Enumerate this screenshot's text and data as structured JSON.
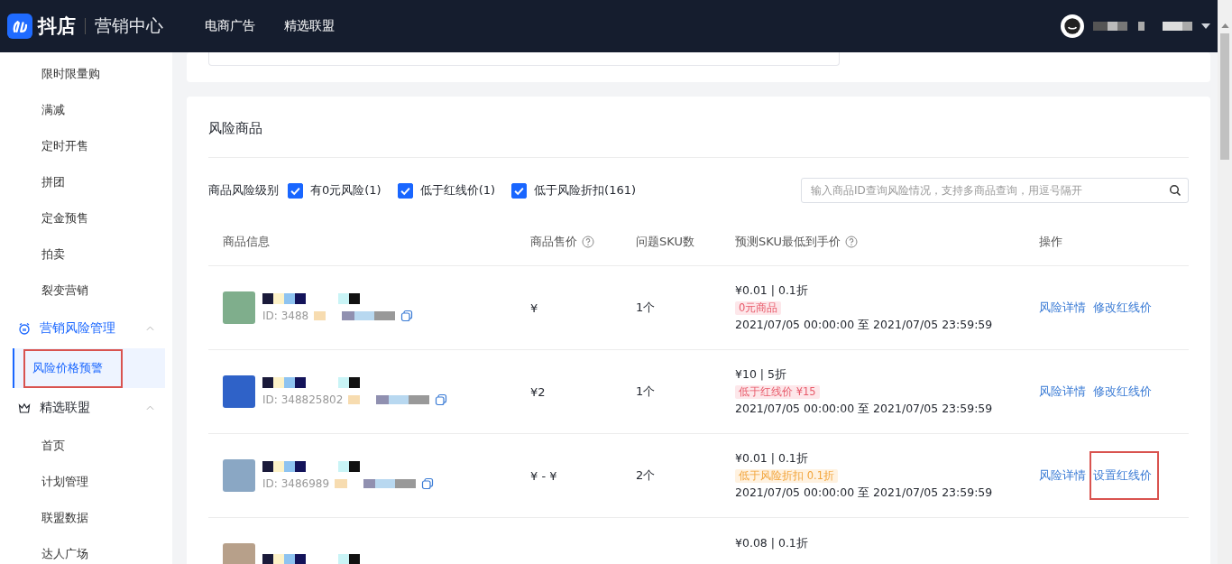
{
  "header": {
    "logo_text": "抖店",
    "section": "营销中心",
    "nav": [
      {
        "label": "电商广告"
      },
      {
        "label": "精选联盟"
      }
    ]
  },
  "sidebar": [
    {
      "kind": "item",
      "label": "限时限量购"
    },
    {
      "kind": "item",
      "label": "满减"
    },
    {
      "kind": "item",
      "label": "定时开售"
    },
    {
      "kind": "item",
      "label": "拼团"
    },
    {
      "kind": "item",
      "label": "定金预售"
    },
    {
      "kind": "item",
      "label": "拍卖"
    },
    {
      "kind": "item",
      "label": "裂变营销"
    },
    {
      "kind": "group",
      "label": "营销风险管理",
      "active": true,
      "expanded": true,
      "children": [
        {
          "label": "风险价格预警",
          "selected": true,
          "highlighted": true
        }
      ]
    },
    {
      "kind": "group",
      "label": "精选联盟",
      "active": false,
      "expanded": true,
      "children": [
        {
          "label": "首页",
          "selected": false,
          "highlighted": false
        },
        {
          "label": "计划管理",
          "selected": false,
          "highlighted": false
        },
        {
          "label": "联盟数据",
          "selected": false,
          "highlighted": false
        },
        {
          "label": "达人广场",
          "selected": false,
          "highlighted": false
        }
      ]
    }
  ],
  "card": {
    "title": "风险商品",
    "filter_label": "商品风险级别",
    "filters": [
      {
        "label": "有0元风险(1)",
        "checked": true
      },
      {
        "label": "低于红线价(1)",
        "checked": true
      },
      {
        "label": "低于风险折扣(161)",
        "checked": true
      }
    ],
    "search": {
      "placeholder": "输入商品ID查询风险情况，支持多商品查询，用逗号隔开"
    },
    "columns": [
      {
        "label": "商品信息",
        "help": false
      },
      {
        "label": "商品售价",
        "help": true
      },
      {
        "label": "问题SKU数",
        "help": false
      },
      {
        "label": "预测SKU最低到手价",
        "help": true
      },
      {
        "label": "操作",
        "help": false
      }
    ],
    "rows": [
      {
        "id": "ID: 3488",
        "price": "¥",
        "sku_count": "1个",
        "lowest": "¥0.01 | 0.1折",
        "tag": {
          "kind": "red",
          "text": "0元商品"
        },
        "period": "2021/07/05 00:00:00 至 2021/07/05 23:59:59",
        "actions": [
          {
            "label": "风险详情",
            "highlighted": false
          },
          {
            "label": "修改红线价",
            "highlighted": false
          }
        ]
      },
      {
        "id": "ID: 348825802",
        "price": "¥2",
        "sku_count": "1个",
        "lowest": "¥10 | 5折",
        "tag": {
          "kind": "red",
          "text": "低于红线价 ¥15"
        },
        "period": "2021/07/05 00:00:00 至 2021/07/05 23:59:59",
        "actions": [
          {
            "label": "风险详情",
            "highlighted": false
          },
          {
            "label": "修改红线价",
            "highlighted": false
          }
        ]
      },
      {
        "id": "ID: 3486989",
        "price": "¥ - ¥",
        "sku_count": "2个",
        "lowest": "¥0.01 | 0.1折",
        "tag": {
          "kind": "orange",
          "text": "低于风险折扣 0.1折"
        },
        "period": "2021/07/05 00:00:00 至 2021/07/05 23:59:59",
        "actions": [
          {
            "label": "风险详情",
            "highlighted": false
          },
          {
            "label": "设置红线价",
            "highlighted": true
          }
        ]
      },
      {
        "lowest": "¥0.08 | 0.1折"
      }
    ]
  }
}
